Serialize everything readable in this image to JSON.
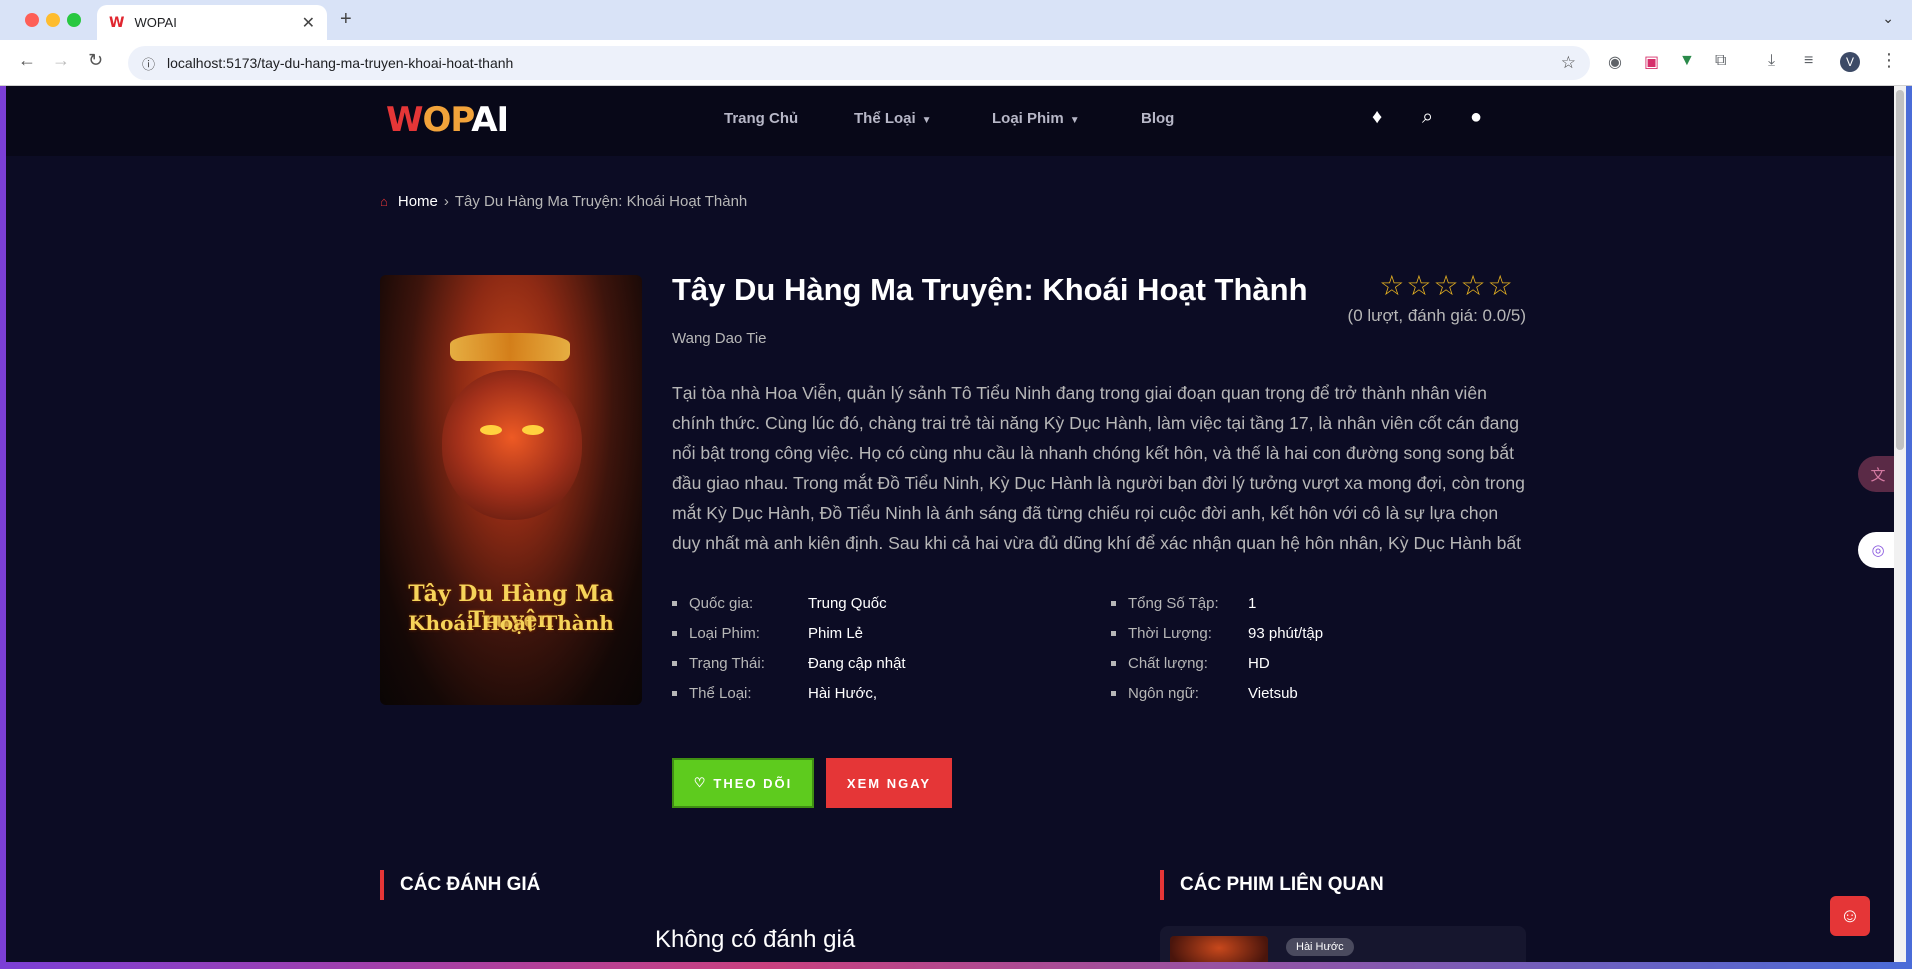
{
  "browser": {
    "tab_title": "WOPAI",
    "tab_favicon": "W",
    "url": "localhost:5173/tay-du-hang-ma-truyen-khoai-hoat-thanh",
    "profile_initial": "V"
  },
  "site": {
    "logo": {
      "w": "W",
      "o": "O",
      "p": "P",
      "ai": "AI"
    },
    "nav": {
      "home": "Trang Chủ",
      "genre": "Thể Loại",
      "type": "Loại Phim",
      "blog": "Blog"
    }
  },
  "breadcrumb": {
    "home": "Home",
    "current": "Tây Du Hàng Ma Truyện: Khoái Hoạt Thành"
  },
  "poster": {
    "line1": "Tây Du Hàng Ma Truyện",
    "line2": "Khoái Hoạt Thành"
  },
  "movie": {
    "title": "Tây Du Hàng Ma Truyện: Khoái Hoạt Thành",
    "original_name": "Wang Dao Tie",
    "rating_text": "(0 lượt, đánh giá: 0.0/5)",
    "rating_value": 0,
    "rating_max": 5,
    "description": "Tại tòa nhà Hoa Viễn, quản lý sảnh Tô Tiểu Ninh đang trong giai đoạn quan trọng để trở thành nhân viên chính thức. Cùng lúc đó, chàng trai trẻ tài năng Kỳ Dục Hành, làm việc tại tầng 17, là nhân viên cốt cán đang nổi bật trong công việc. Họ có cùng nhu cầu là nhanh chóng kết hôn, và thế là hai con đường song song bắt đầu giao nhau. Trong mắt Đồ Tiểu Ninh, Kỳ Dục Hành là người bạn đời lý tưởng vượt xa mong đợi, còn trong mắt Kỳ Dục Hành, Đồ Tiểu Ninh là ánh sáng đã từng chiếu rọi cuộc đời anh, kết hôn với cô là sự lựa chọn duy nhất mà anh kiên định. Sau khi cả hai vừa đủ dũng khí để xác nhận quan hệ hôn nhân, Kỳ Dục Hành bất ngờ trở thành cấp trên của Đồ Tiểu Ninh. Họ, những người bạn học từ mười nă…",
    "info_left": [
      {
        "label": "Quốc gia:",
        "value": "Trung Quốc"
      },
      {
        "label": "Loại Phim:",
        "value": "Phim Lẻ"
      },
      {
        "label": "Trạng Thái:",
        "value": "Đang cập nhật"
      },
      {
        "label": "Thể Loại:",
        "value": "Hài Hước,"
      }
    ],
    "info_right": [
      {
        "label": "Tổng Số Tập:",
        "value": "1"
      },
      {
        "label": "Thời Lượng:",
        "value": "93 phút/tập"
      },
      {
        "label": "Chất lượng:",
        "value": "HD"
      },
      {
        "label": "Ngôn ngữ:",
        "value": "Vietsub"
      }
    ]
  },
  "buttons": {
    "follow": "THEO DÕI",
    "watch": "XEM NGAY"
  },
  "sections": {
    "reviews_title": "CÁC ĐÁNH GIÁ",
    "no_reviews": "Không có đánh giá",
    "related_title": "CÁC PHIM LIÊN QUAN",
    "related_badge": "Hài Hước"
  },
  "colors": {
    "accent_red": "#e53637",
    "follow_green": "#5ecb1e",
    "star_gold": "#e8b321",
    "page_bg": "#0c0c24"
  },
  "icons": [
    "star-icon",
    "heart-icon",
    "search-icon",
    "user-icon",
    "gem-icon",
    "home-icon"
  ]
}
